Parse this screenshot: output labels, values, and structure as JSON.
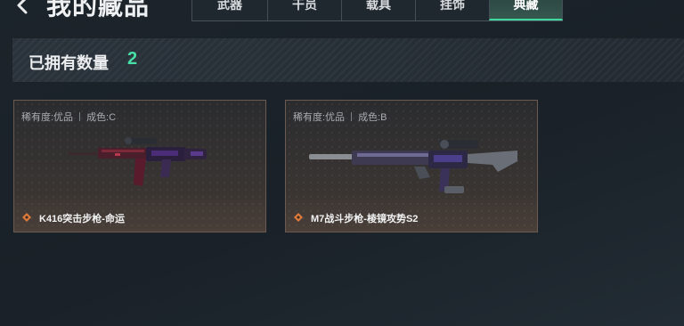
{
  "header": {
    "title": "我的藏品",
    "tabs": [
      {
        "label": "武器",
        "active": false
      },
      {
        "label": "干员",
        "active": false
      },
      {
        "label": "载具",
        "active": false
      },
      {
        "label": "挂饰",
        "active": false
      },
      {
        "label": "典藏",
        "active": true
      }
    ]
  },
  "owned": {
    "label": "已拥有数量",
    "count": "2"
  },
  "items": [
    {
      "rarity": "稀有度:优品",
      "condition": "成色:C",
      "name": "K416突击步枪-命运",
      "icon": "diamond-icon"
    },
    {
      "rarity": "稀有度:优品",
      "condition": "成色:B",
      "name": "M7战斗步枪-棱镜攻势S2",
      "icon": "diamond-icon"
    }
  ],
  "colors": {
    "accent_green": "#46e0a6",
    "icon_orange": "#e07a3a"
  }
}
